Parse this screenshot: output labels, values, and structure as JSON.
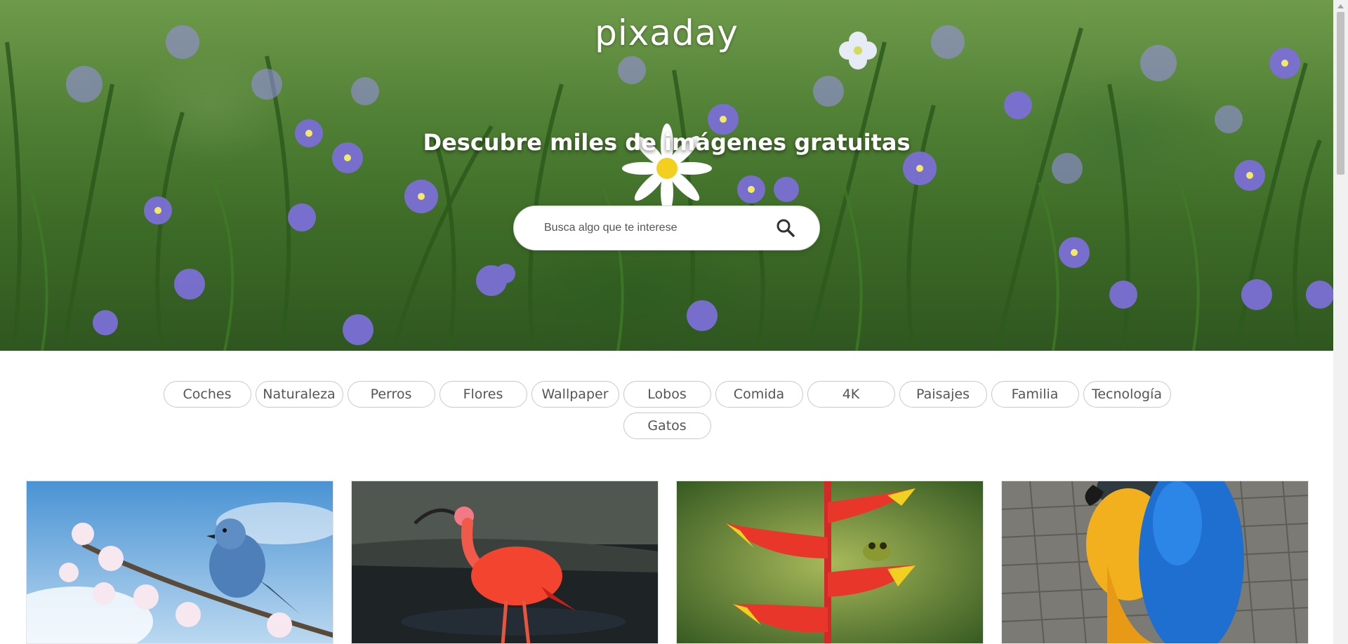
{
  "brand": {
    "logo": "pixaday"
  },
  "hero": {
    "title": "Descubre miles de imágenes gratuitas",
    "search": {
      "placeholder": "Busca algo que te interese",
      "value": ""
    }
  },
  "tags": [
    "Coches",
    "Naturaleza",
    "Perros",
    "Flores",
    "Wallpaper",
    "Lobos",
    "Comida",
    "4K",
    "Paisajes",
    "Familia",
    "Tecnología",
    "Gatos"
  ],
  "gallery": [
    {
      "subject": "blue bird on blossoming branch"
    },
    {
      "subject": "scarlet ibis in water"
    },
    {
      "subject": "heliconia flower with frog"
    },
    {
      "subject": "blue and yellow macaw"
    }
  ],
  "colors": {
    "accent_text": "#555555",
    "tag_border": "#c9c9c9",
    "hero_green": "#4f7f34",
    "flower_purple": "#7b6fd6"
  },
  "icons": {
    "search": "search-icon"
  }
}
